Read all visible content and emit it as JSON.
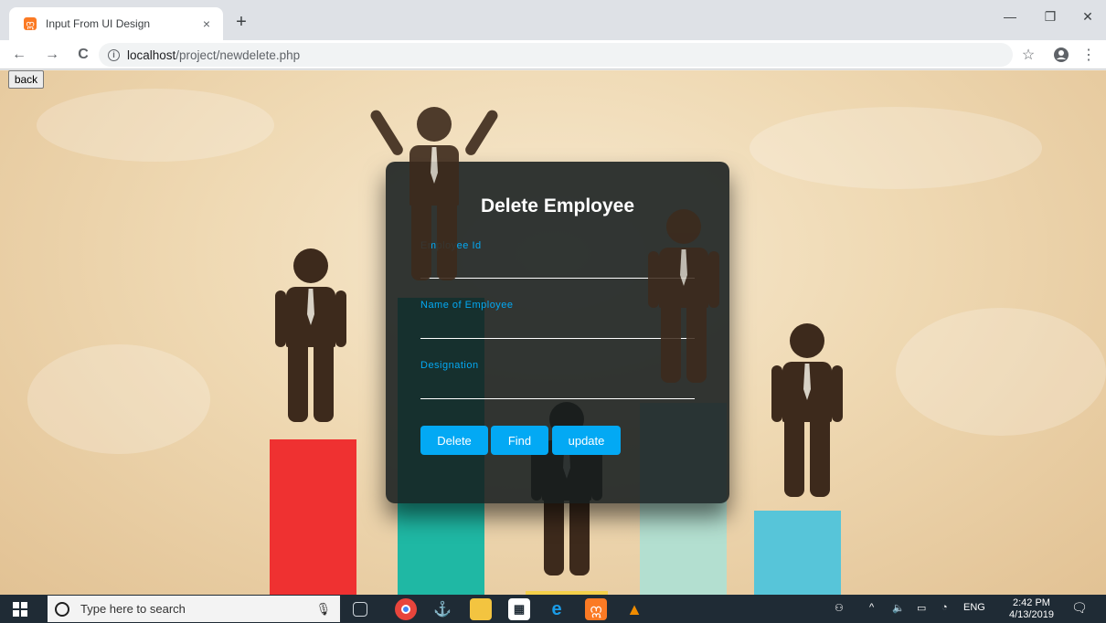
{
  "browser": {
    "tab_title": "Input From UI Design",
    "tab_close": "×",
    "new_tab": "+",
    "window_min": "—",
    "window_restore": "❐",
    "window_close": "✕",
    "back": "←",
    "forward": "→",
    "reload": "C",
    "url_host": "localhost",
    "url_path": "/project/newdelete.php",
    "star": "☆",
    "menu": "⋮"
  },
  "page": {
    "back_button": "back"
  },
  "form": {
    "title": "Delete Employee",
    "fields": [
      {
        "label": "Employee Id",
        "value": ""
      },
      {
        "label": "Name of Employee",
        "value": ""
      },
      {
        "label": "Designation",
        "value": ""
      }
    ],
    "buttons": {
      "delete": "Delete",
      "find": "Find",
      "update": "update"
    }
  },
  "taskbar": {
    "search_placeholder": "Type here to search",
    "tray_lang": "ENG",
    "time": "2:42 PM",
    "date": "4/13/2019"
  },
  "colors": {
    "accent": "#03a9f4",
    "panel": "#161c1e",
    "bar_red": "#ef3131",
    "bar_teal": "#1fb8a4",
    "bar_light_green": "#b3dfd0",
    "bar_blue": "#57c5d9",
    "bar_yellow": "#f4d04a"
  }
}
